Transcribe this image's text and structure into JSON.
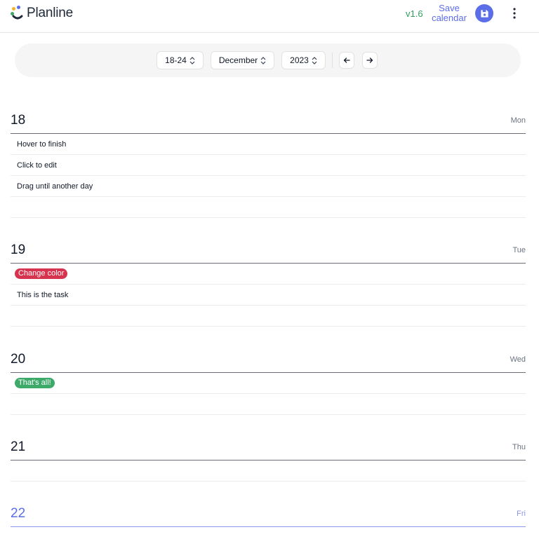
{
  "app": {
    "name": "Planline",
    "version": "v1.6",
    "save_label_line1": "Save",
    "save_label_line2": "calendar",
    "colors": {
      "accent": "#5b6ee8",
      "version": "#2f9e5b"
    },
    "icons": {
      "save": "floppy-disk-icon",
      "more": "vertical-dots-icon"
    }
  },
  "toolbar": {
    "range": "18-24",
    "month": "December",
    "year": "2023",
    "prev_icon": "arrow-left-icon",
    "next_icon": "arrow-right-icon"
  },
  "days": [
    {
      "num": "18",
      "name": "Mon",
      "tasks": [
        {
          "text": "Hover to finish"
        },
        {
          "text": "Click to edit"
        },
        {
          "text": "Drag until another day"
        }
      ]
    },
    {
      "num": "19",
      "name": "Tue",
      "tasks": [
        {
          "text": "Change color",
          "color": "#d6334e"
        },
        {
          "text": "This is the task"
        }
      ]
    },
    {
      "num": "20",
      "name": "Wed",
      "tasks": [
        {
          "text": "That's all!",
          "color": "#3daa6a"
        }
      ]
    },
    {
      "num": "21",
      "name": "Thu",
      "tasks": []
    },
    {
      "num": "22",
      "name": "Fri",
      "tasks": [],
      "today": true
    }
  ]
}
